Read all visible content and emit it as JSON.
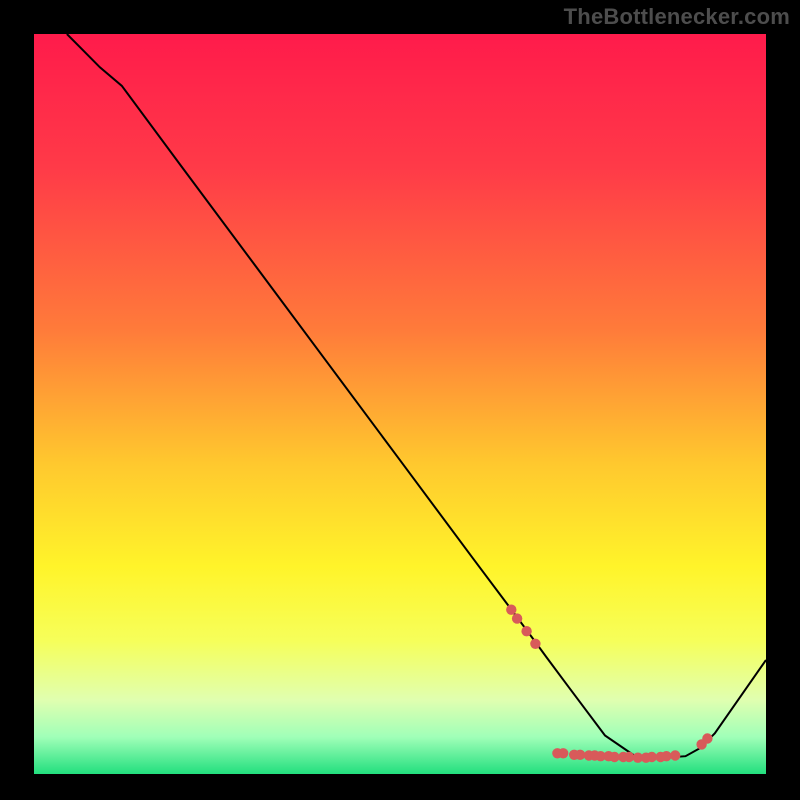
{
  "attribution": "TheBottlenecker.com",
  "chart_data": {
    "type": "line",
    "title": "",
    "xlabel": "",
    "ylabel": "",
    "xlim": [
      0,
      100
    ],
    "ylim": [
      0,
      100
    ],
    "gradient_stops": [
      {
        "offset": 0,
        "color": "#ff1b4b"
      },
      {
        "offset": 18,
        "color": "#ff3a48"
      },
      {
        "offset": 40,
        "color": "#ff7b3a"
      },
      {
        "offset": 58,
        "color": "#ffc82e"
      },
      {
        "offset": 72,
        "color": "#fff42a"
      },
      {
        "offset": 82,
        "color": "#f6ff5a"
      },
      {
        "offset": 90,
        "color": "#e0ffb0"
      },
      {
        "offset": 95,
        "color": "#a0ffb8"
      },
      {
        "offset": 100,
        "color": "#22df7e"
      }
    ],
    "series": [
      {
        "name": "bottleneck-curve",
        "color": "#000000",
        "x": [
          4.5,
          6.5,
          9,
          12,
          20,
          30,
          40,
          50,
          60,
          65,
          68,
          70,
          73,
          78,
          82,
          86,
          89,
          91,
          93,
          100
        ],
        "y": [
          100,
          98,
          95.5,
          93,
          82.3,
          69,
          55.7,
          42.4,
          29.1,
          22.5,
          18.5,
          15.8,
          11.8,
          5.2,
          2.5,
          2.2,
          2.4,
          3.5,
          5.5,
          15.4
        ]
      }
    ],
    "marker_series": {
      "name": "optimal-range-markers",
      "color": "#d85a5a",
      "points": [
        {
          "x": 65.2,
          "y": 22.2
        },
        {
          "x": 66.0,
          "y": 21.0
        },
        {
          "x": 67.3,
          "y": 19.3
        },
        {
          "x": 68.5,
          "y": 17.6
        },
        {
          "x": 71.5,
          "y": 2.8
        },
        {
          "x": 72.3,
          "y": 2.8
        },
        {
          "x": 73.8,
          "y": 2.6
        },
        {
          "x": 74.6,
          "y": 2.6
        },
        {
          "x": 75.8,
          "y": 2.5
        },
        {
          "x": 76.6,
          "y": 2.5
        },
        {
          "x": 77.4,
          "y": 2.4
        },
        {
          "x": 78.5,
          "y": 2.4
        },
        {
          "x": 79.3,
          "y": 2.3
        },
        {
          "x": 80.5,
          "y": 2.3
        },
        {
          "x": 81.3,
          "y": 2.3
        },
        {
          "x": 82.5,
          "y": 2.2
        },
        {
          "x": 83.6,
          "y": 2.2
        },
        {
          "x": 84.4,
          "y": 2.3
        },
        {
          "x": 85.6,
          "y": 2.3
        },
        {
          "x": 86.4,
          "y": 2.4
        },
        {
          "x": 87.6,
          "y": 2.5
        },
        {
          "x": 91.2,
          "y": 4.0
        },
        {
          "x": 92.0,
          "y": 4.8
        }
      ]
    }
  }
}
